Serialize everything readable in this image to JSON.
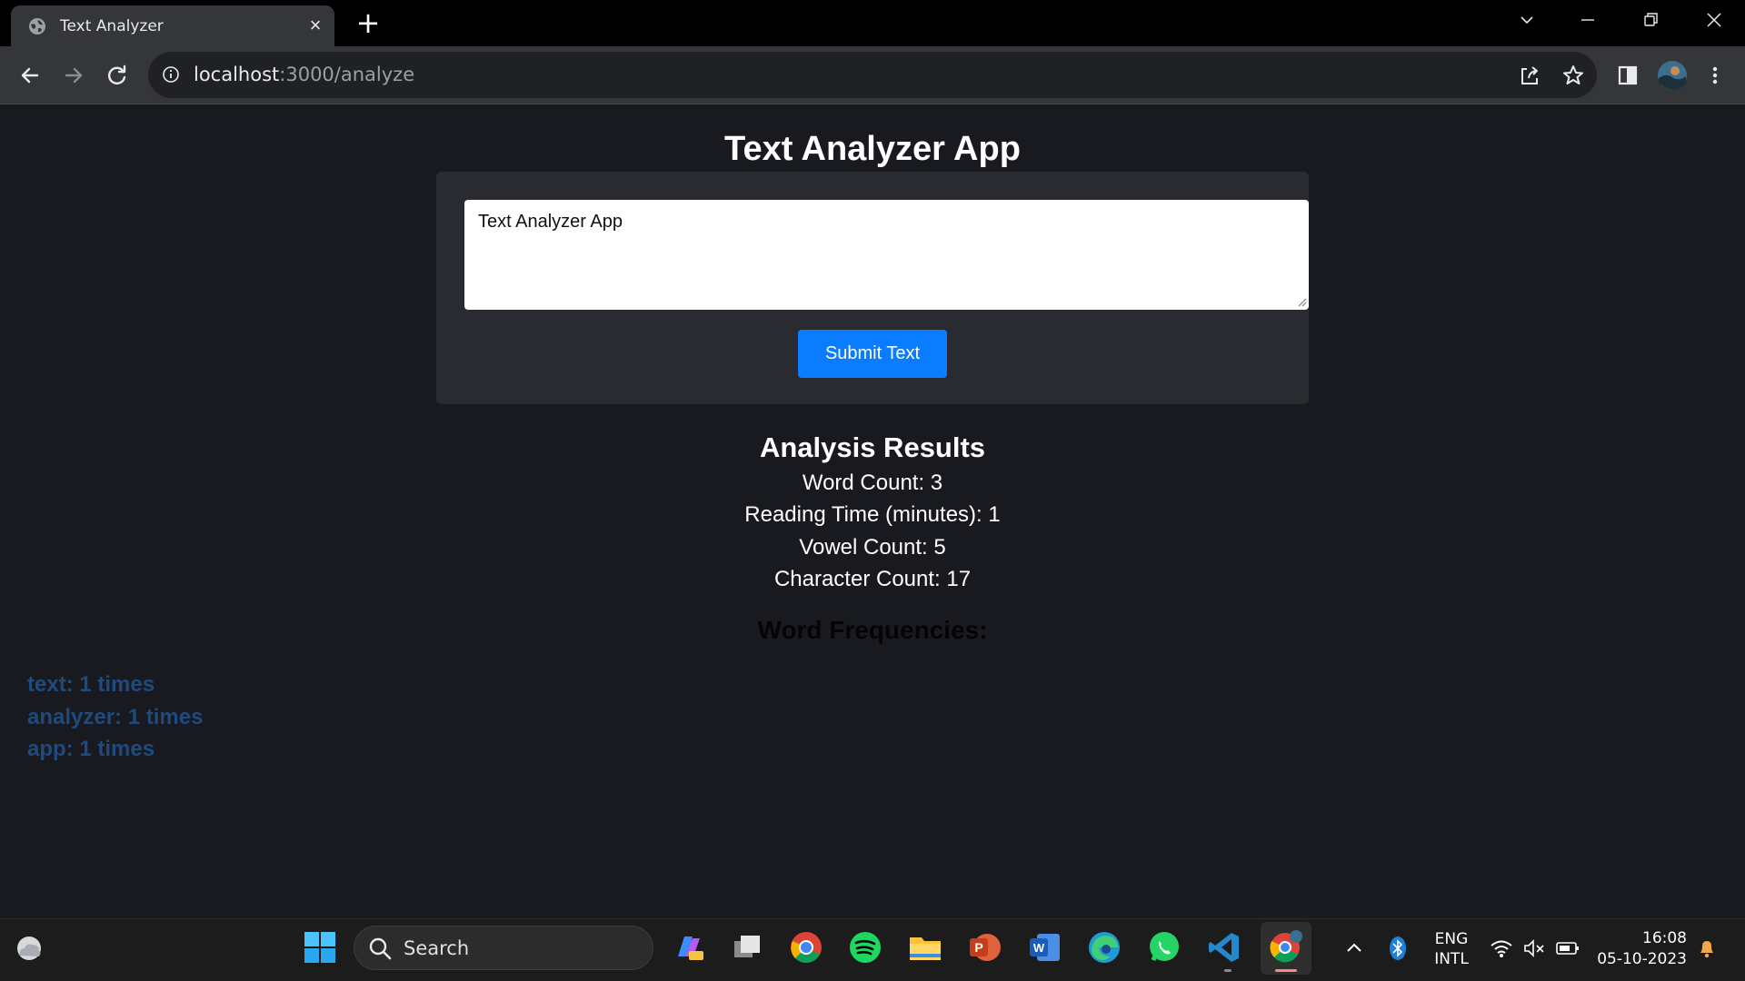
{
  "browser": {
    "tab_title": "Text Analyzer",
    "url_host": "localhost",
    "url_path": ":3000/analyze"
  },
  "page": {
    "title": "Text Analyzer App",
    "textarea_value": "Text Analyzer App",
    "submit_label": "Submit Text",
    "results_heading": "Analysis Results",
    "results": [
      "Word Count: 3",
      "Reading Time (minutes): 1",
      "Vowel Count: 5",
      "Character Count: 17"
    ],
    "frequencies_heading": "Word Frequencies:",
    "frequencies": [
      "text: 1 times",
      "analyzer: 1 times",
      "app: 1 times"
    ]
  },
  "taskbar": {
    "search_label": "Search",
    "language_line1": "ENG",
    "language_line2": "INTL",
    "time": "16:08",
    "date": "05-10-2023"
  },
  "colors": {
    "page_bg": "#181a20",
    "card_bg": "#2a2b30",
    "button_blue": "#0a7cff",
    "frequency_text": "#1e4a7e"
  }
}
